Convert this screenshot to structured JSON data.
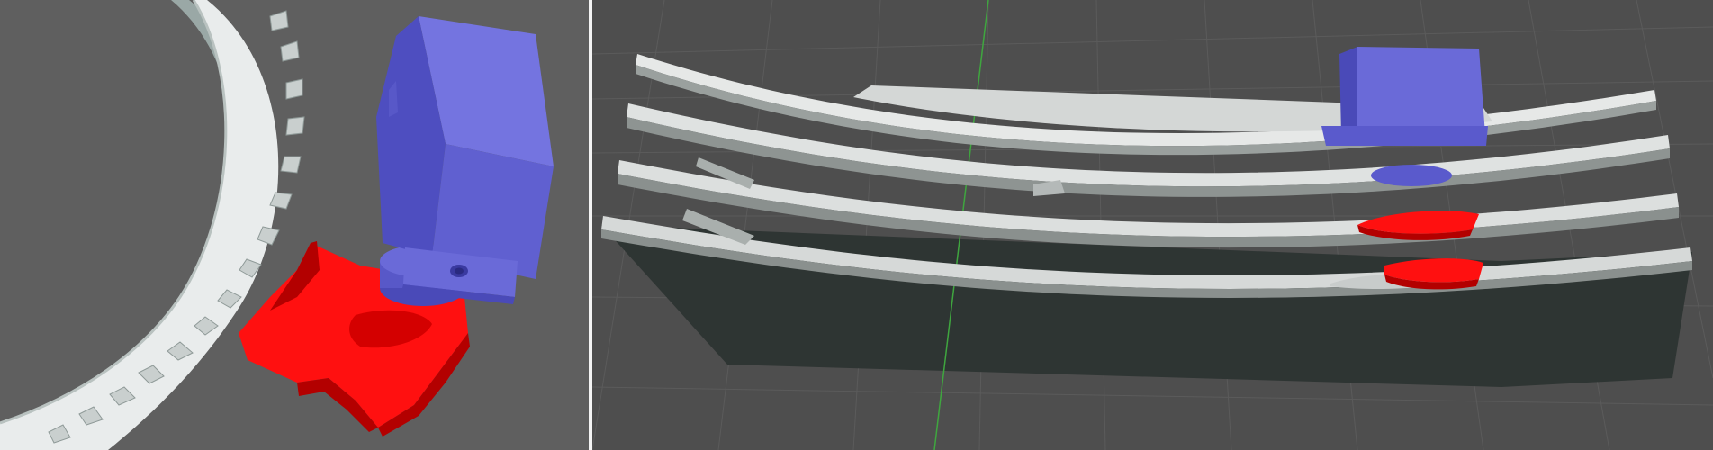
{
  "window": {
    "title": "",
    "views": [
      {
        "name": "top-view",
        "label": ""
      },
      {
        "name": "side-view",
        "label": ""
      }
    ]
  },
  "colors": {
    "left_background": "#5f5f5f",
    "right_background": "#4e4e4e",
    "divider": "#f4f4f4",
    "ring_plate": "#e9ecec",
    "ring_shadow": "#9aa8a6",
    "servo_blue": "#6a6ad8",
    "servo_blue_dark": "#4a4ab8",
    "arm_red": "#ff1010",
    "arm_red_dark": "#b30000",
    "base_block": "#2e3533",
    "plate_light": "#d9dcdb",
    "grid_line": "#5a5a5a",
    "axis_green": "#3fa63f"
  },
  "objects": {
    "left": [
      "gear-ring",
      "servo-body",
      "servo-mount-tab",
      "mount-hole",
      "servo-horn",
      "red-arm"
    ],
    "right": [
      "base-block",
      "curved-plate-1",
      "curved-plate-2",
      "curved-plate-3",
      "curved-plate-4",
      "servo-body",
      "servo-horn",
      "red-arm-upper",
      "red-arm-lower",
      "green-axis"
    ]
  }
}
